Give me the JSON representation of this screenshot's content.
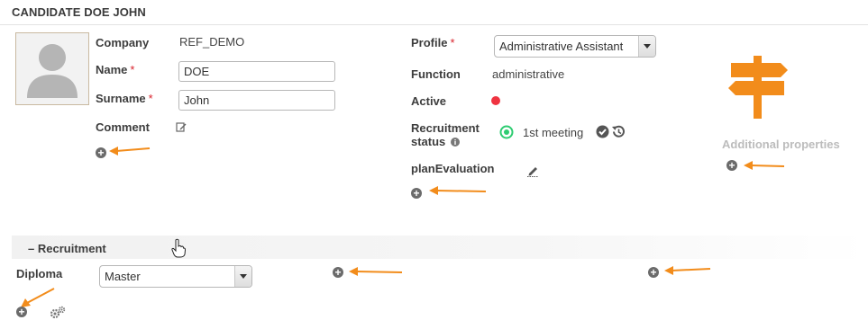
{
  "header": {
    "title": "CANDIDATE DOE JOHN"
  },
  "form": {
    "company_label": "Company",
    "company_value": "REF_DEMO",
    "name_label": "Name",
    "name_value": "DOE",
    "surname_label": "Surname",
    "surname_value": "John",
    "comment_label": "Comment",
    "required_marker": "*"
  },
  "details": {
    "profile_label": "Profile",
    "profile_value": "Administrative Assistant",
    "function_label": "Function",
    "function_value": "administrative",
    "active_label": "Active",
    "recruitment_label_line1": "Recruitment",
    "recruitment_label_line2": "status",
    "recruitment_status": "1st meeting",
    "plan_label": "planEvaluation"
  },
  "side": {
    "additional_properties": "Additional properties"
  },
  "recruitment": {
    "collapse_symbol": "–",
    "section_title": "Recruitment",
    "diploma_label": "Diploma",
    "diploma_value": "Master"
  },
  "icons": {
    "avatar": "user-silhouette-icon",
    "edit": "pencil-edit-icon",
    "signpost": "signpost-icon",
    "add": "plus-circle-icon",
    "settings": "gears-icon",
    "info": "info-icon",
    "status": "target-circle-icon",
    "check": "check-circle-icon",
    "history": "history-icon",
    "cursor": "hand-pointer-icon",
    "annotation": "orange-arrow-icon"
  },
  "colors": {
    "accent_orange": "#f28c1b",
    "required_red": "#d9232d",
    "active_dot": "#ef3340",
    "status_green": "#2ecc71"
  }
}
